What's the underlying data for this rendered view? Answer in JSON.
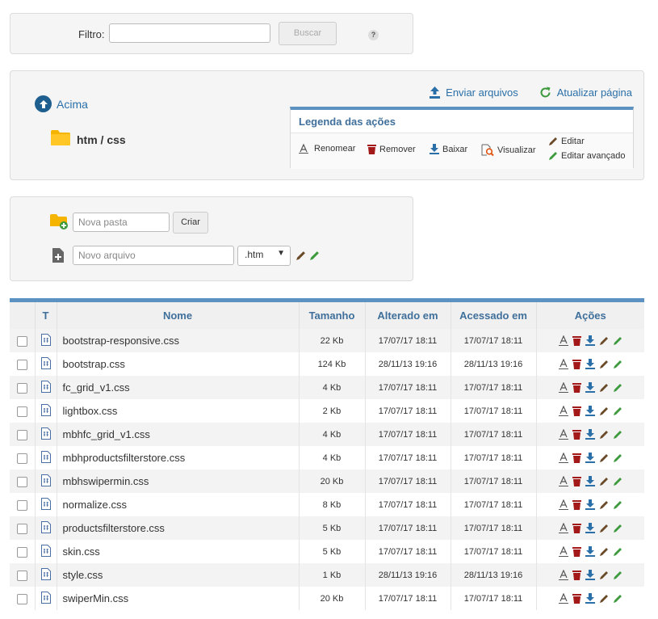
{
  "filter": {
    "label": "Filtro:",
    "value": "",
    "search_label": "Buscar",
    "help_label": "?"
  },
  "navigation": {
    "up_label": "Acima",
    "current_path": "htm / css",
    "upload_label": "Enviar arquivos",
    "refresh_label": "Atualizar página"
  },
  "legend": {
    "title": "Legenda das ações",
    "rename": "Renomear",
    "remove": "Remover",
    "download": "Baixar",
    "view": "Visualizar",
    "edit": "Editar",
    "advanced_edit": "Editar avançado"
  },
  "create": {
    "folder_placeholder": "Nova pasta",
    "create_label": "Criar",
    "file_placeholder": "Novo arquivo",
    "extension": ".htm"
  },
  "table": {
    "headers": {
      "type": "T",
      "name": "Nome",
      "size": "Tamanho",
      "modified": "Alterado em",
      "accessed": "Acessado em",
      "actions": "Ações"
    },
    "rows": [
      {
        "name": "bootstrap-responsive.css",
        "size": "22 Kb",
        "modified": "17/07/17 18:11",
        "accessed": "17/07/17 18:11"
      },
      {
        "name": "bootstrap.css",
        "size": "124 Kb",
        "modified": "28/11/13 19:16",
        "accessed": "28/11/13 19:16"
      },
      {
        "name": "fc_grid_v1.css",
        "size": "4 Kb",
        "modified": "17/07/17 18:11",
        "accessed": "17/07/17 18:11"
      },
      {
        "name": "lightbox.css",
        "size": "2 Kb",
        "modified": "17/07/17 18:11",
        "accessed": "17/07/17 18:11"
      },
      {
        "name": "mbhfc_grid_v1.css",
        "size": "4 Kb",
        "modified": "17/07/17 18:11",
        "accessed": "17/07/17 18:11"
      },
      {
        "name": "mbhproductsfilterstore.css",
        "size": "4 Kb",
        "modified": "17/07/17 18:11",
        "accessed": "17/07/17 18:11"
      },
      {
        "name": "mbhswipermin.css",
        "size": "20 Kb",
        "modified": "17/07/17 18:11",
        "accessed": "17/07/17 18:11"
      },
      {
        "name": "normalize.css",
        "size": "8 Kb",
        "modified": "17/07/17 18:11",
        "accessed": "17/07/17 18:11"
      },
      {
        "name": "productsfilterstore.css",
        "size": "5 Kb",
        "modified": "17/07/17 18:11",
        "accessed": "17/07/17 18:11"
      },
      {
        "name": "skin.css",
        "size": "5 Kb",
        "modified": "17/07/17 18:11",
        "accessed": "17/07/17 18:11"
      },
      {
        "name": "style.css",
        "size": "1 Kb",
        "modified": "28/11/13 19:16",
        "accessed": "28/11/13 19:16"
      },
      {
        "name": "swiperMin.css",
        "size": "20 Kb",
        "modified": "17/07/17 18:11",
        "accessed": "17/07/17 18:11"
      }
    ]
  },
  "colors": {
    "accent_blue": "#2a6fa8",
    "header_blue": "#5b92c2",
    "remove_red": "#a31818",
    "edit_brown": "#6b4a2a",
    "edit_green": "#3d9a3d",
    "folder_yellow": "#f5b400"
  },
  "icons": {
    "up": "arrow-up-circle-icon",
    "folder": "folder-icon",
    "upload": "upload-icon",
    "refresh": "refresh-icon",
    "rename": "rename-icon",
    "remove": "trash-icon",
    "download": "download-icon",
    "view": "magnify-icon",
    "edit": "pencil-icon",
    "advanced_edit": "pencil-green-icon",
    "new_folder": "folder-plus-icon",
    "new_file": "file-plus-icon",
    "css_file": "css-file-icon"
  }
}
